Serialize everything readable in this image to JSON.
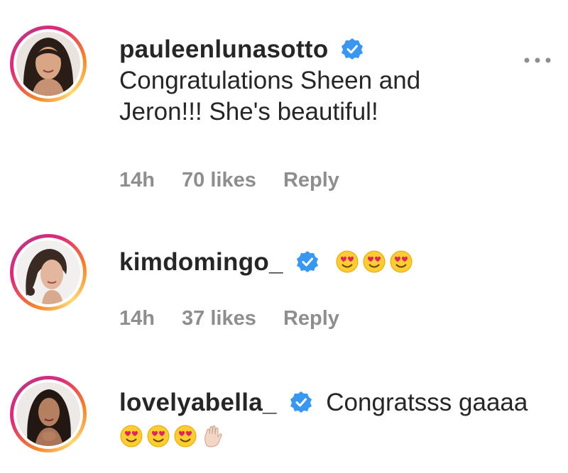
{
  "comments": [
    {
      "username": "pauleenlunasotto",
      "verified": true,
      "text_lines": [
        "Congratulations Sheen and",
        "Jeron!!! She's beautiful!"
      ],
      "time": "14h",
      "likes": "70 likes",
      "reply": "Reply",
      "avatar": "woman-portrait-photo"
    },
    {
      "username": "kimdomingo_",
      "verified": true,
      "emojis": [
        "heart-eyes-emoji",
        "heart-eyes-emoji",
        "heart-eyes-emoji"
      ],
      "time": "14h",
      "likes": "37 likes",
      "reply": "Reply",
      "avatar": "woman-portrait-photo"
    },
    {
      "username": "lovelyabella_",
      "verified": true,
      "text": "Congratsss gaaaa",
      "emojis": [
        "heart-eyes-emoji",
        "heart-eyes-emoji",
        "heart-eyes-emoji",
        "waving-hand-emoji"
      ],
      "avatar": "woman-portrait-photo"
    }
  ],
  "more_options_icon": "more-horizontal-icon",
  "colors": {
    "verified_blue": "#3897f0",
    "meta_gray": "#8e8e8e",
    "text": "#262626",
    "emoji_yellow": "#ffcc33",
    "heart_red": "#e0245e"
  }
}
